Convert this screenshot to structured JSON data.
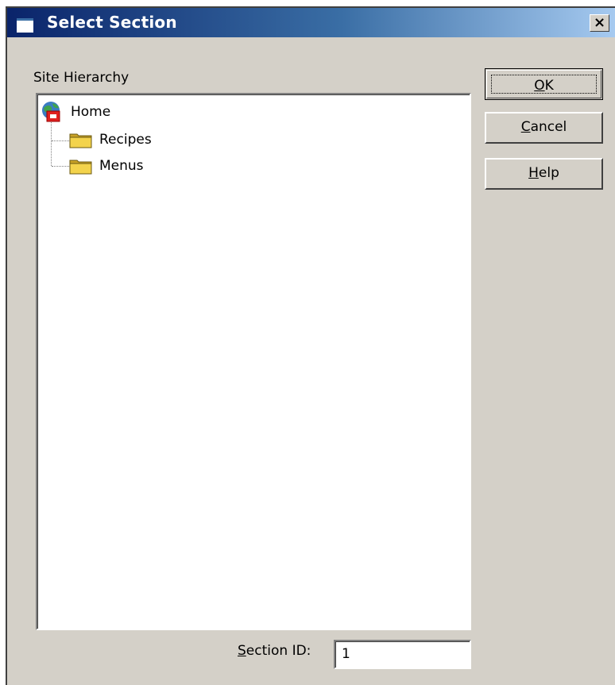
{
  "window": {
    "title": "Select Section",
    "close_label": "×"
  },
  "tree": {
    "group_label": "Site Hierarchy",
    "nodes": [
      {
        "label": "Home",
        "icon": "home-site-icon"
      },
      {
        "label": "Recipes",
        "icon": "folder-icon"
      },
      {
        "label": "Menus",
        "icon": "folder-icon"
      }
    ]
  },
  "buttons": {
    "ok_prefix": "",
    "ok_key": "O",
    "ok_rest": "K",
    "cancel_key": "C",
    "cancel_rest": "ancel",
    "help_key": "H",
    "help_rest": "elp"
  },
  "section_id": {
    "label_key": "S",
    "label_rest": "ection ID:",
    "value": "1"
  },
  "colors": {
    "dialog_bg": "#d4d0c8",
    "title_start": "#0a246a",
    "title_end": "#a6caf0",
    "folder_yellow": "#f3d34c"
  }
}
